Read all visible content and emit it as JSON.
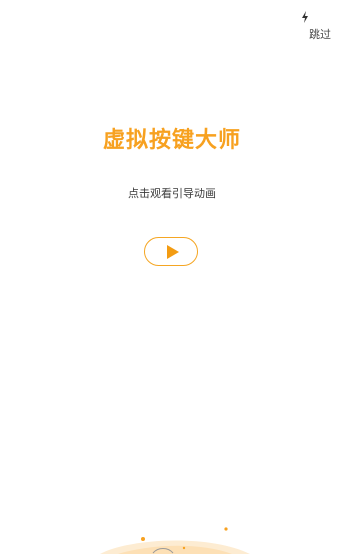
{
  "header": {
    "skip_label": "跳过",
    "status_icon": "lightning-icon"
  },
  "splash": {
    "title": "虚拟按键大师",
    "subtitle": "点击观看引导动画",
    "play_icon": "play-icon"
  },
  "colors": {
    "accent": "#f7a120",
    "play_border": "#f5a623",
    "text_dark": "#3a3a3a"
  }
}
